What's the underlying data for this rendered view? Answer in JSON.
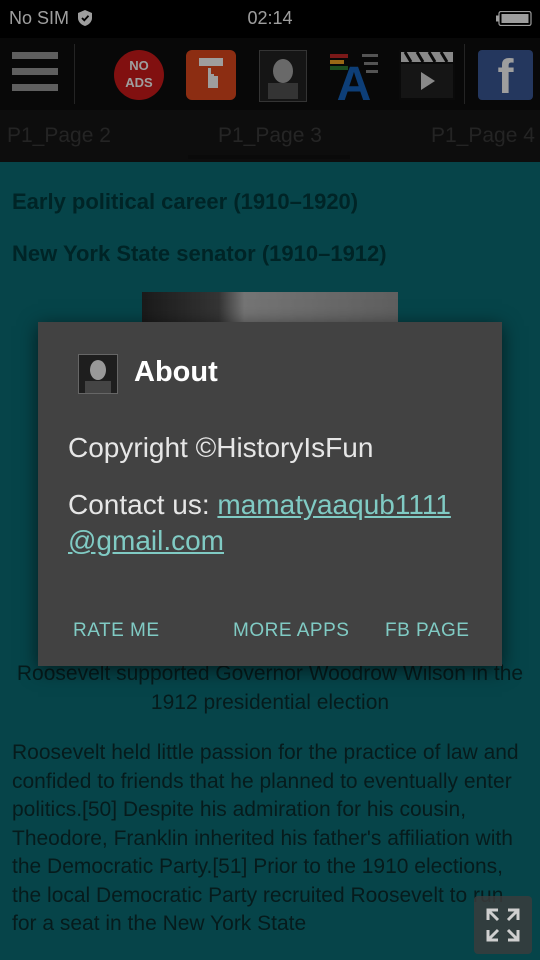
{
  "status": {
    "carrier": "No SIM",
    "time": "02:14"
  },
  "toolbar": {
    "items": [
      {
        "name": "menu",
        "icon": "hamburger-menu-icon"
      },
      {
        "name": "no-ads",
        "label": "NO\nADS"
      },
      {
        "name": "donate",
        "icon": "donate-hand-icon"
      },
      {
        "name": "portrait",
        "icon": "roosevelt-portrait-icon"
      },
      {
        "name": "font",
        "icon": "font-size-icon",
        "glyph": "A"
      },
      {
        "name": "video",
        "icon": "video-clapper-icon"
      },
      {
        "name": "facebook",
        "icon": "facebook-icon",
        "glyph": "f"
      }
    ]
  },
  "tabs": [
    {
      "label": "P1_Page 2",
      "active": false
    },
    {
      "label": "P1_Page 3",
      "active": true
    },
    {
      "label": "P1_Page 4",
      "active": false
    }
  ],
  "content": {
    "heading1": "Early political career (1910–1920)",
    "heading2": "New York State senator (1910–1912)",
    "caption": "Roosevelt supported Governor Woodrow Wilson in the 1912 presidential election",
    "body": "Roosevelt held little passion for the practice of law and confided to friends that he planned to eventually enter politics.[50] Despite his admiration for his cousin, Theodore, Franklin inherited his father's affiliation with the Democratic Party.[51] Prior to the 1910 elections, the local Democratic Party recruited Roosevelt to run for a seat in the New York State"
  },
  "dialog": {
    "title": "About",
    "copyright": "Copyright ©HistoryIsFun",
    "contact_label": "Contact us: ",
    "contact_email": "mamatyaaqub1111@gmail.com",
    "buttons": {
      "rate": "RATE ME",
      "more": "MORE APPS",
      "fb": "FB PAGE"
    }
  },
  "colors": {
    "background": "#0a6f76",
    "dialog": "#424242",
    "accent": "#80cbc4"
  }
}
